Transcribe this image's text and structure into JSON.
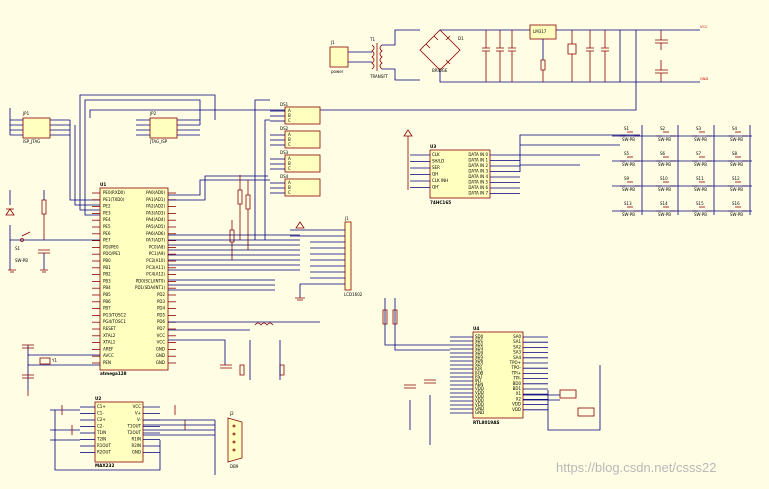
{
  "watermark": "https://blog.csdn.net/csss22",
  "components": {
    "u1": {
      "ref": "U1",
      "name": "atmega128",
      "pins_left": [
        "PE0(RXD0)",
        "PE1(TXD0)",
        "PE2",
        "PE3",
        "PE4",
        "PE5",
        "PE6",
        "PE7",
        "PDI/PE0",
        "PDO/PE1",
        "PB0",
        "PB1",
        "PB2",
        "PB3",
        "PB4",
        "PB5",
        "PB6",
        "PB7",
        "PG3/TOSC2",
        "PG4/TOSC1",
        "RESET",
        "XTAL2",
        "XTAL1",
        "AREF",
        "AVCC",
        "PEN"
      ],
      "pins_right": [
        "PA0(AD0)",
        "PA1(AD1)",
        "PA2(AD2)",
        "PA3(AD3)",
        "PA4(AD4)",
        "PA5(AD5)",
        "PA6(AD6)",
        "PA7(AD7)",
        "PC0(A8)",
        "PC1(A9)",
        "PC2(A10)",
        "PC3(A11)",
        "PC4(A12)",
        "PD0(SCL/INT0)",
        "PD1(SDA/INT1)",
        "PD2",
        "PD3",
        "PD4",
        "PD5",
        "PD6",
        "PD7",
        "VCC",
        "VCC",
        "GND",
        "GND",
        "GND"
      ]
    },
    "u2": {
      "ref": "U2",
      "name": "MAX232",
      "pins": [
        "C1+",
        "C1-",
        "C2+",
        "C2-",
        "T1IN",
        "T2IN",
        "R1OUT",
        "R2OUT",
        "VCC",
        "V+",
        "V-",
        "T1OUT",
        "T2OUT",
        "R1IN",
        "R2IN",
        "GND"
      ]
    },
    "u3": {
      "ref": "U3",
      "name": "74HC165",
      "pins_left": [
        "CLK",
        "SH/LD",
        "SER",
        "QH",
        "CLK INH",
        "QH'"
      ],
      "pins_right": [
        "DATA IN 0",
        "DATA IN 1",
        "DATA IN 2",
        "DATA IN 3",
        "DATA IN 4",
        "DATA IN 5",
        "DATA IN 6",
        "DATA IN 7"
      ]
    },
    "u4": {
      "ref": "U4",
      "name": "RTL8019AS",
      "pins_left": [
        "SD0",
        "SD1",
        "SD2",
        "SD3",
        "SD4",
        "SD5",
        "SD6",
        "SD7",
        "IOR",
        "IOW",
        "RST",
        "INT",
        "AEN",
        "VDD",
        "VDD",
        "VDD",
        "VDD",
        "VDD",
        "GND",
        "GND"
      ],
      "pins_right": [
        "SA0",
        "SA1",
        "SA2",
        "SA3",
        "SA4",
        "TPO+",
        "TPO-",
        "TPI+",
        "TPI-",
        "BD0",
        "BD1",
        "X1",
        "X2",
        "VDD",
        "VDD"
      ]
    },
    "jp1": {
      "ref": "JP1",
      "name": "ISP_JTAG"
    },
    "jp2": {
      "ref": "JP2",
      "name": "JTAG_ISP"
    },
    "j1": {
      "ref": "J1",
      "name": "power"
    },
    "t1": {
      "ref": "T1",
      "name": "TRANSFT"
    },
    "d1": {
      "ref": "D1",
      "name": "BRIDGE"
    },
    "u5": {
      "ref": "U5",
      "name": "LM317"
    },
    "jlcd": {
      "ref": "J1",
      "name": "LCD1602"
    },
    "db9": {
      "ref": "J2",
      "name": "DB9"
    },
    "reset": {
      "ref": "S1",
      "name": "SW-PB"
    },
    "xtal": {
      "ref": "Y1",
      "name": "XTAL"
    }
  },
  "keys": [
    {
      "ref": "S1",
      "name": "SW-PB"
    },
    {
      "ref": "S2",
      "name": "SW-PB"
    },
    {
      "ref": "S3",
      "name": "SW-PB"
    },
    {
      "ref": "S4",
      "name": "SW-PB"
    },
    {
      "ref": "S5",
      "name": "SW-PB"
    },
    {
      "ref": "S6",
      "name": "SW-PB"
    },
    {
      "ref": "S7",
      "name": "SW-PB"
    },
    {
      "ref": "S8",
      "name": "SW-PB"
    },
    {
      "ref": "S9",
      "name": "SW-PB"
    },
    {
      "ref": "S10",
      "name": "SW-PB"
    },
    {
      "ref": "S11",
      "name": "SW-PB"
    },
    {
      "ref": "S12",
      "name": "SW-PB"
    },
    {
      "ref": "S13",
      "name": "SW-PB"
    },
    {
      "ref": "S14",
      "name": "SW-PB"
    },
    {
      "ref": "S15",
      "name": "SW-PB"
    },
    {
      "ref": "S16",
      "name": "SW-PB"
    }
  ],
  "seg_boxes": [
    {
      "ref": "DS1",
      "pins": [
        "A",
        "B",
        "C"
      ]
    },
    {
      "ref": "DS2",
      "pins": [
        "A",
        "B",
        "C"
      ]
    },
    {
      "ref": "DS3",
      "pins": [
        "A",
        "B",
        "C"
      ]
    },
    {
      "ref": "DS4",
      "pins": [
        "A",
        "B",
        "C"
      ]
    }
  ],
  "net_labels": [
    "VCC",
    "GND",
    "VCC",
    "VCC",
    "VCC"
  ]
}
